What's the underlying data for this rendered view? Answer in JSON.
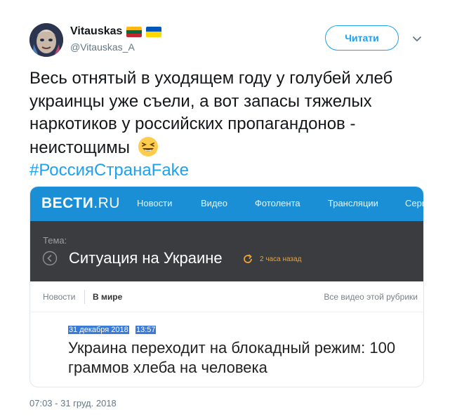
{
  "author": {
    "display_name": "Vitauskas",
    "handle": "@Vitauskas_A",
    "flags": [
      "flag-lithuania",
      "flag-ukraine"
    ]
  },
  "follow_button": {
    "label": "Читати"
  },
  "tweet": {
    "text": "Весь отнятый в уходящем году у голубей хлеб украинцы уже съели, а вот запасы тяжелых наркотиков у российских пропагандонов - неистощимы",
    "emoji": "laughing-face-emoji",
    "hashtag": "#РоссияСтранаFake",
    "timestamp": "07:03 - 31 груд. 2018"
  },
  "card": {
    "logo_main": "ВЕСТИ",
    "logo_suffix": ".RU",
    "nav_items": [
      "Новости",
      "Видео",
      "Фотолента",
      "Трансляции",
      "Серв"
    ],
    "topic_label": "Тема:",
    "topic_title": "Ситуация на Украине",
    "topic_time": "2 часа назад",
    "subnav": {
      "news": "Новости",
      "world": "В мире",
      "all_videos": "Все видео этой рубрики"
    },
    "article_date": "31 декабря 2018",
    "article_time": "13:57",
    "article_title": "Украина переходит на блокадный режим: 100 граммов хлеба на человека"
  },
  "colors": {
    "twitter_blue": "#1da1f2",
    "vesti_blue": "#1a8fd6",
    "topic_bg": "#3a3c40",
    "accent_orange": "#f0a22e"
  }
}
